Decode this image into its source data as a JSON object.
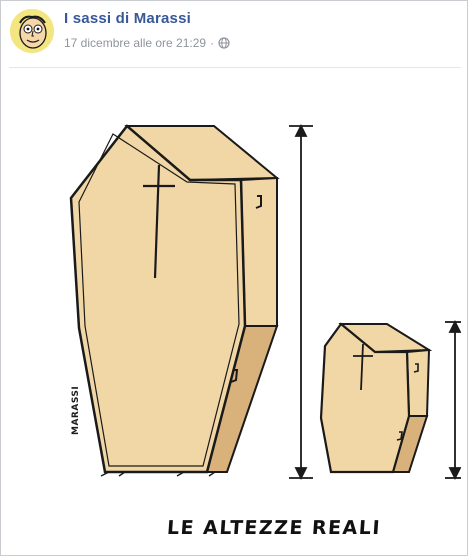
{
  "post": {
    "page_name": "I sassi di Marassi",
    "timestamp": "17 dicembre alle ore 21:29",
    "separator": "·",
    "privacy_icon": "globe-icon"
  },
  "cartoon": {
    "signature": "MARASSI",
    "caption": "LE ALTEZZE REALI"
  },
  "colors": {
    "link": "#385898",
    "meta": "#90949c",
    "coffin_light": "#f2d7a6",
    "coffin_dark": "#d8b27a",
    "outline": "#1a1a1a"
  }
}
